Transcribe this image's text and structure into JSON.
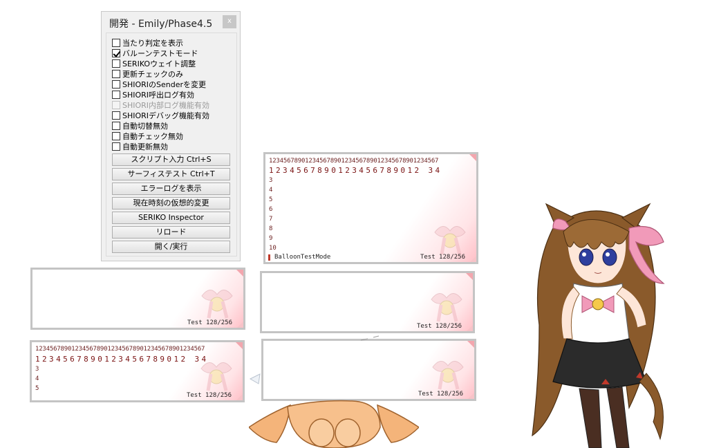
{
  "dev_panel": {
    "title": "開発 - Emily/Phase4.5",
    "close_label": "x",
    "checkboxes": [
      {
        "label": "当たり判定を表示",
        "checked": false,
        "enabled": true
      },
      {
        "label": "バルーンテストモード",
        "checked": true,
        "enabled": true
      },
      {
        "label": "SERIKOウェイト調整",
        "checked": false,
        "enabled": true
      },
      {
        "label": "更新チェックのみ",
        "checked": false,
        "enabled": true
      },
      {
        "label": "SHIORIのSenderを変更",
        "checked": false,
        "enabled": true
      },
      {
        "label": "SHIORI呼出ログ有効",
        "checked": false,
        "enabled": true
      },
      {
        "label": "SHIORI内部ログ機能有効",
        "checked": false,
        "enabled": false
      },
      {
        "label": "SHIORIデバッグ機能有効",
        "checked": false,
        "enabled": true
      },
      {
        "label": "自動切替無効",
        "checked": false,
        "enabled": true
      },
      {
        "label": "自動チェック無効",
        "checked": false,
        "enabled": true
      },
      {
        "label": "自動更新無効",
        "checked": false,
        "enabled": true
      }
    ],
    "buttons": [
      {
        "label": "スクリプト入力 Ctrl+S"
      },
      {
        "label": "サーフィステスト Ctrl+T"
      },
      {
        "label": "エラーログを表示"
      },
      {
        "label": "現在時刻の仮想的変更"
      },
      {
        "label": "SERIKO Inspector"
      },
      {
        "label": "リロード"
      },
      {
        "label": "開く/実行"
      }
    ]
  },
  "balloons": {
    "main": {
      "line_small": "12345678901234567890123456789012345678901234567",
      "line_wide": "1234567890123456789012 34",
      "lines": [
        "3",
        "4",
        "5",
        "6",
        "7",
        "8",
        "9",
        "10"
      ],
      "mode": "BalloonTestMode",
      "status": "Test 128/256"
    },
    "left_top": {
      "status": "Test 128/256"
    },
    "center_top": {
      "status": "Test 128/256"
    },
    "left_bottom": {
      "line_small": "12345678901234567890123456789012345678901234567",
      "line_wide": "1234567890123456789012 34",
      "lines": [
        "3",
        "4",
        "5"
      ],
      "status": "Test 128/256"
    },
    "center_bottom": {
      "status": "Test 128/256"
    }
  },
  "colors": {
    "balloon_border": "#c4c4c4",
    "balloon_accent": "#f3a6ae",
    "text_dark_red": "#7a1212"
  }
}
